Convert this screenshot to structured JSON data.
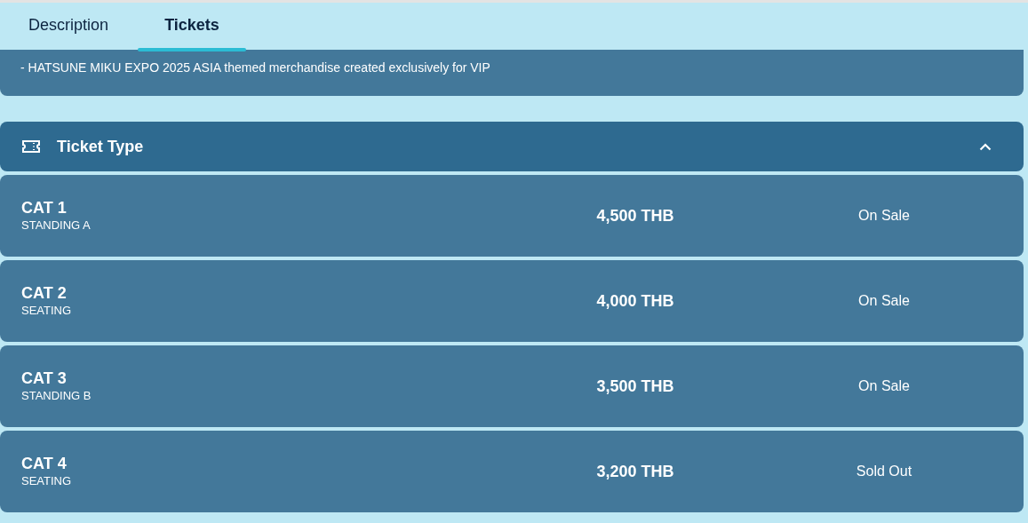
{
  "tabs": [
    {
      "label": "Description",
      "selected": false
    },
    {
      "label": "Tickets",
      "selected": true
    }
  ],
  "description": {
    "lines": [
      "- HATSUNE MIKU EXPO 2025 ASIA themed merchandise created exclusively for VIP"
    ]
  },
  "ticket_section": {
    "title": "Ticket Type",
    "expanded": true,
    "rows": [
      {
        "name": "CAT 1",
        "zone": "STANDING A",
        "price": "4,500 THB",
        "status": "On Sale"
      },
      {
        "name": "CAT 2",
        "zone": "SEATING",
        "price": "4,000 THB",
        "status": "On Sale"
      },
      {
        "name": "CAT 3",
        "zone": "STANDING B",
        "price": "3,500 THB",
        "status": "On Sale"
      },
      {
        "name": "CAT 4",
        "zone": "SEATING",
        "price": "3,200 THB",
        "status": "Sold Out"
      }
    ]
  }
}
